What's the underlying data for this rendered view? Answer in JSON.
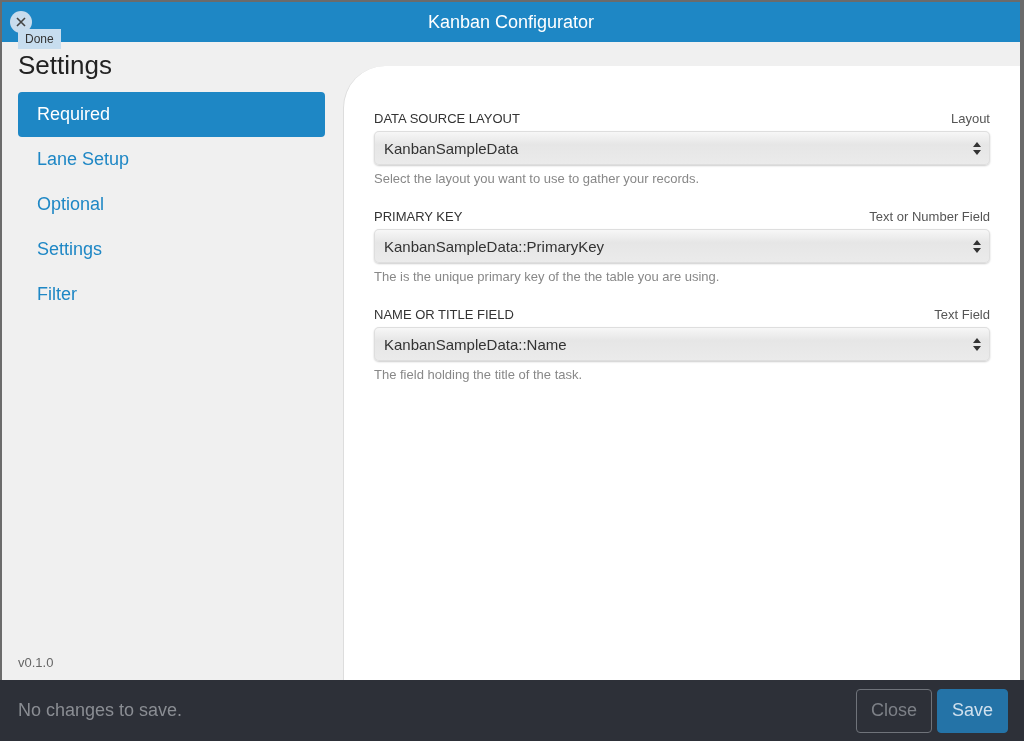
{
  "window": {
    "title": "Kanban Configurator",
    "close_tooltip": "Done"
  },
  "sidebar": {
    "title": "Settings",
    "version": "v0.1.0",
    "items": [
      {
        "label": "Required",
        "selected": true
      },
      {
        "label": "Lane Setup",
        "selected": false
      },
      {
        "label": "Optional",
        "selected": false
      },
      {
        "label": "Settings",
        "selected": false
      },
      {
        "label": "Filter",
        "selected": false
      }
    ]
  },
  "fields": [
    {
      "label": "DATA SOURCE LAYOUT",
      "type": "Layout",
      "value": "KanbanSampleData",
      "help": "Select the layout you want to use to gather your records."
    },
    {
      "label": "PRIMARY KEY",
      "type": "Text or Number Field",
      "value": "KanbanSampleData::PrimaryKey",
      "help": "The is the unique primary key of the the table you are using."
    },
    {
      "label": "NAME OR TITLE FIELD",
      "type": "Text Field",
      "value": "KanbanSampleData::Name",
      "help": "The field holding the title of the task."
    }
  ],
  "status_bar": {
    "message": "No changes to save.",
    "buttons": [
      {
        "label": "Close",
        "kind": "secondary"
      },
      {
        "label": "Save",
        "kind": "primary"
      }
    ]
  }
}
